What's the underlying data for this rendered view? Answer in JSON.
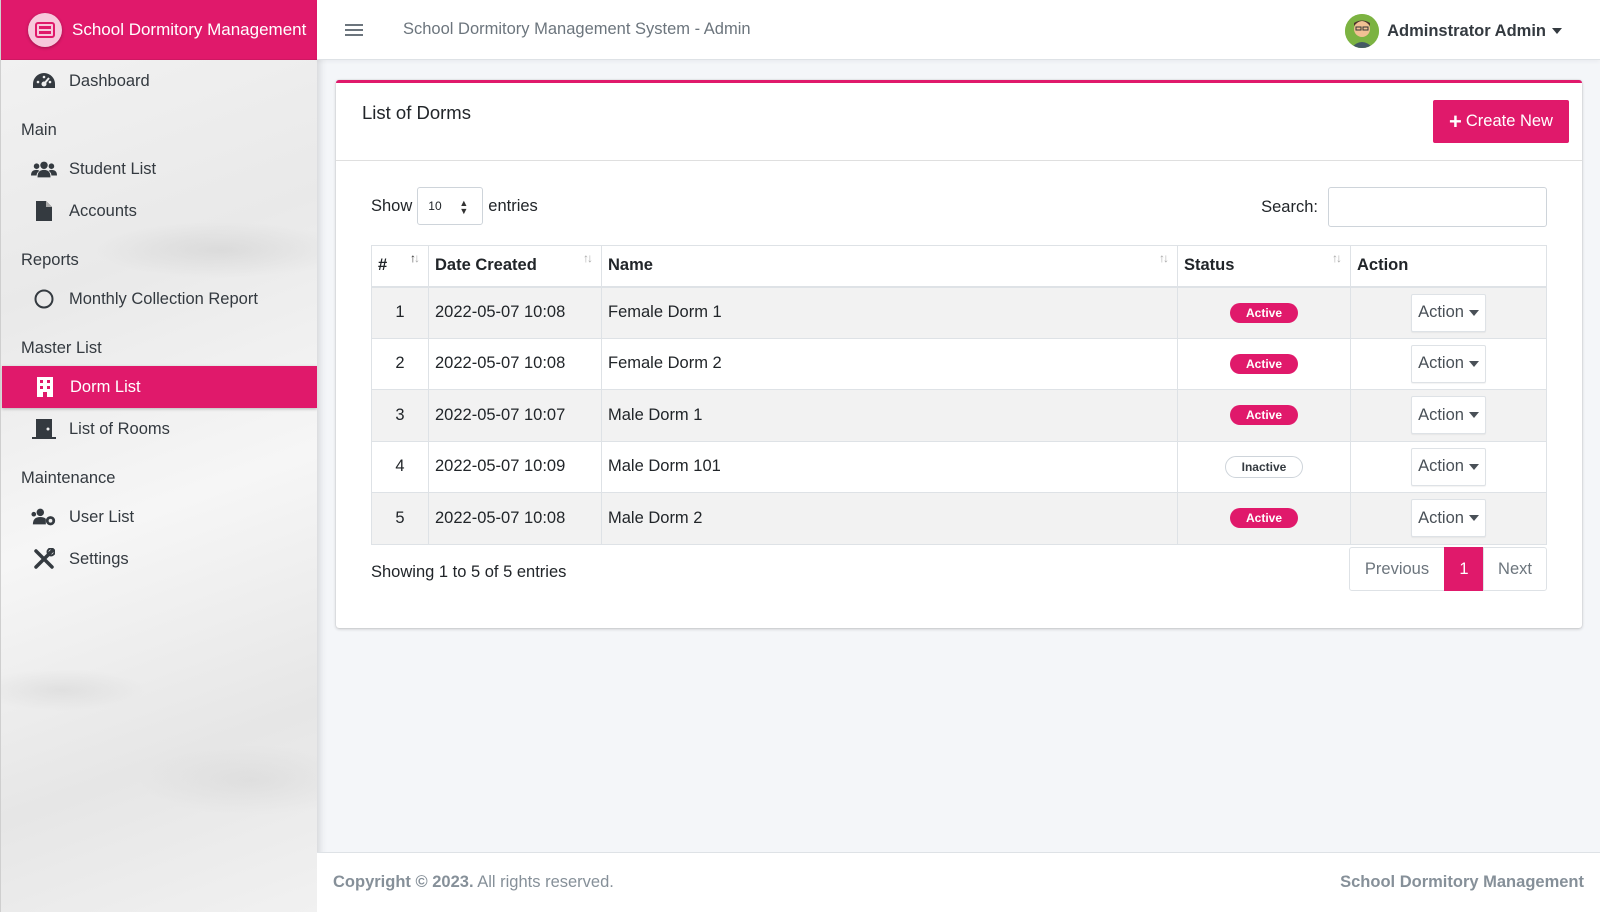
{
  "brand": {
    "title": "School Dormitory Management",
    "logo_icon": "dormitory-logo-icon"
  },
  "topbar": {
    "title": "School Dormitory Management System - Admin",
    "user_name": "Adminstrator Admin",
    "menu_icon": "hamburger-icon"
  },
  "sidebar": {
    "dashboard": "Dashboard",
    "section_main": "Main",
    "student_list": "Student List",
    "accounts": "Accounts",
    "section_reports": "Reports",
    "monthly_report": "Monthly Collection Report",
    "section_master": "Master List",
    "dorm_list": "Dorm List",
    "list_of_rooms": "List of Rooms",
    "section_maintenance": "Maintenance",
    "user_list": "User List",
    "settings": "Settings"
  },
  "card": {
    "title": "List of Dorms",
    "create_label": "Create New",
    "show_label": "Show",
    "entries_label": "entries",
    "page_size": "10",
    "search_label": "Search:",
    "search_value": ""
  },
  "table": {
    "headers": [
      "#",
      "Date Created",
      "Name",
      "Status",
      "Action"
    ],
    "rows": [
      {
        "num": "1",
        "date": "2022-05-07 10:08",
        "name": "Female Dorm 1",
        "status": "Active",
        "action": "Action"
      },
      {
        "num": "2",
        "date": "2022-05-07 10:08",
        "name": "Female Dorm 2",
        "status": "Active",
        "action": "Action"
      },
      {
        "num": "3",
        "date": "2022-05-07 10:07",
        "name": "Male Dorm 1",
        "status": "Active",
        "action": "Action"
      },
      {
        "num": "4",
        "date": "2022-05-07 10:09",
        "name": "Male Dorm 101",
        "status": "Inactive",
        "action": "Action"
      },
      {
        "num": "5",
        "date": "2022-05-07 10:08",
        "name": "Male Dorm 2",
        "status": "Active",
        "action": "Action"
      }
    ]
  },
  "pagination": {
    "info": "Showing 1 to 5 of 5 entries",
    "previous": "Previous",
    "current": "1",
    "next": "Next"
  },
  "footer": {
    "copyright": "Copyright © 2023.",
    "rights": "All rights reserved.",
    "right_text": "School Dormitory Management"
  },
  "colors": {
    "accent": "#e0196b",
    "sidebar_bg": "#eeeeee"
  }
}
